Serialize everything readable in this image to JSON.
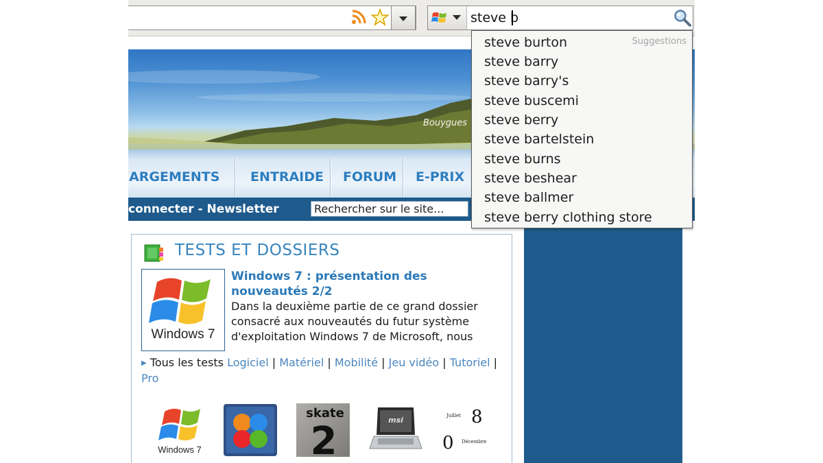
{
  "toolbar": {
    "search_engine": "windows-live-search",
    "search_query": "steve b"
  },
  "banner": {
    "brand_text": "Bouygues"
  },
  "nav": {
    "items": [
      "IARGEMENTS",
      "ENTRAIDE",
      "FORUM",
      "E-PRIX"
    ]
  },
  "subbar": {
    "links_text": "connecter - Newsletter",
    "search_placeholder": "Rechercher sur le site..."
  },
  "section": {
    "title": "TESTS ET DOSSIERS",
    "article": {
      "thumb_caption": "Windows 7",
      "title": "Windows 7 : présentation des nouveautés 2/2",
      "body": "Dans la deuxième partie de ce grand dossier consacré aux nouveautés du futur système d'exploitation Windows 7 de Microsoft, nous"
    },
    "tests_links": {
      "all": "Tous les tests",
      "logiciel": "Logiciel",
      "materiel": "Matériel",
      "mobilite": "Mobilité",
      "jeu_video": "Jeu vidéo",
      "tutoriel": "Tutoriel",
      "pro": "Pro",
      "sep": "|"
    },
    "thumbnails": {
      "windows7_caption": "Windows 7",
      "skate_text": "skate",
      "skate_number": "2",
      "laptop_brand": "msi",
      "calendar": {
        "month1": "Juillet",
        "day1": "8",
        "day2": "0",
        "month2": "Décembre"
      }
    }
  },
  "suggestions": {
    "label": "Suggestions",
    "items": [
      "steve burton",
      "steve barry",
      "steve barry's",
      "steve buscemi",
      "steve berry",
      "steve bartelstein",
      "steve burns",
      "steve beshear",
      "steve ballmer",
      "steve berry clothing store"
    ]
  },
  "colors": {
    "nav_text": "#2c7dbf",
    "subbar_bg": "#1e5a8c",
    "section_title": "#3785be",
    "link": "#4a86bf"
  }
}
